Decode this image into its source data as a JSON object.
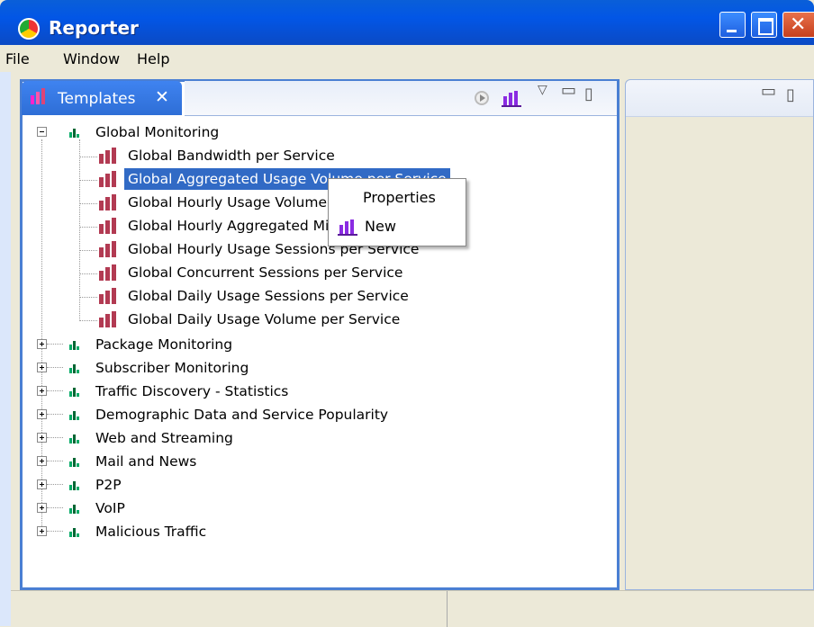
{
  "window": {
    "title": "Reporter"
  },
  "menu": [
    "File",
    "Window",
    "Help"
  ],
  "tab": {
    "label": "Templates",
    "close": "✕"
  },
  "tree": {
    "expanded_group": {
      "label": "Global Monitoring",
      "children": [
        "Global Bandwidth per Service",
        "Global Aggregated Usage Volume per Service",
        "Global Hourly Usage Volume",
        "Global Hourly Aggregated Mi",
        "Global Hourly Usage Sessions per Service",
        "Global Concurrent Sessions per Service",
        "Global Daily Usage Sessions per Service",
        "Global Daily Usage Volume per Service"
      ],
      "selected_index": 1
    },
    "collapsed_groups": [
      "Package Monitoring",
      "Subscriber Monitoring",
      "Traffic Discovery - Statistics",
      "Demographic Data and Service Popularity",
      "Web and Streaming",
      "Mail and News",
      "P2P",
      "VoIP",
      "Malicious Traffic"
    ]
  },
  "context_menu": {
    "items": [
      "Properties",
      "New"
    ]
  },
  "colors": {
    "title_bar": "#0a5fd8",
    "selection": "#316ac5",
    "chart_icon": "#b23a52"
  },
  "icons": [
    "app-icon",
    "templates-icon",
    "run-icon",
    "chart-icon",
    "view-menu-icon",
    "minimize-icon",
    "maximize-icon"
  ]
}
